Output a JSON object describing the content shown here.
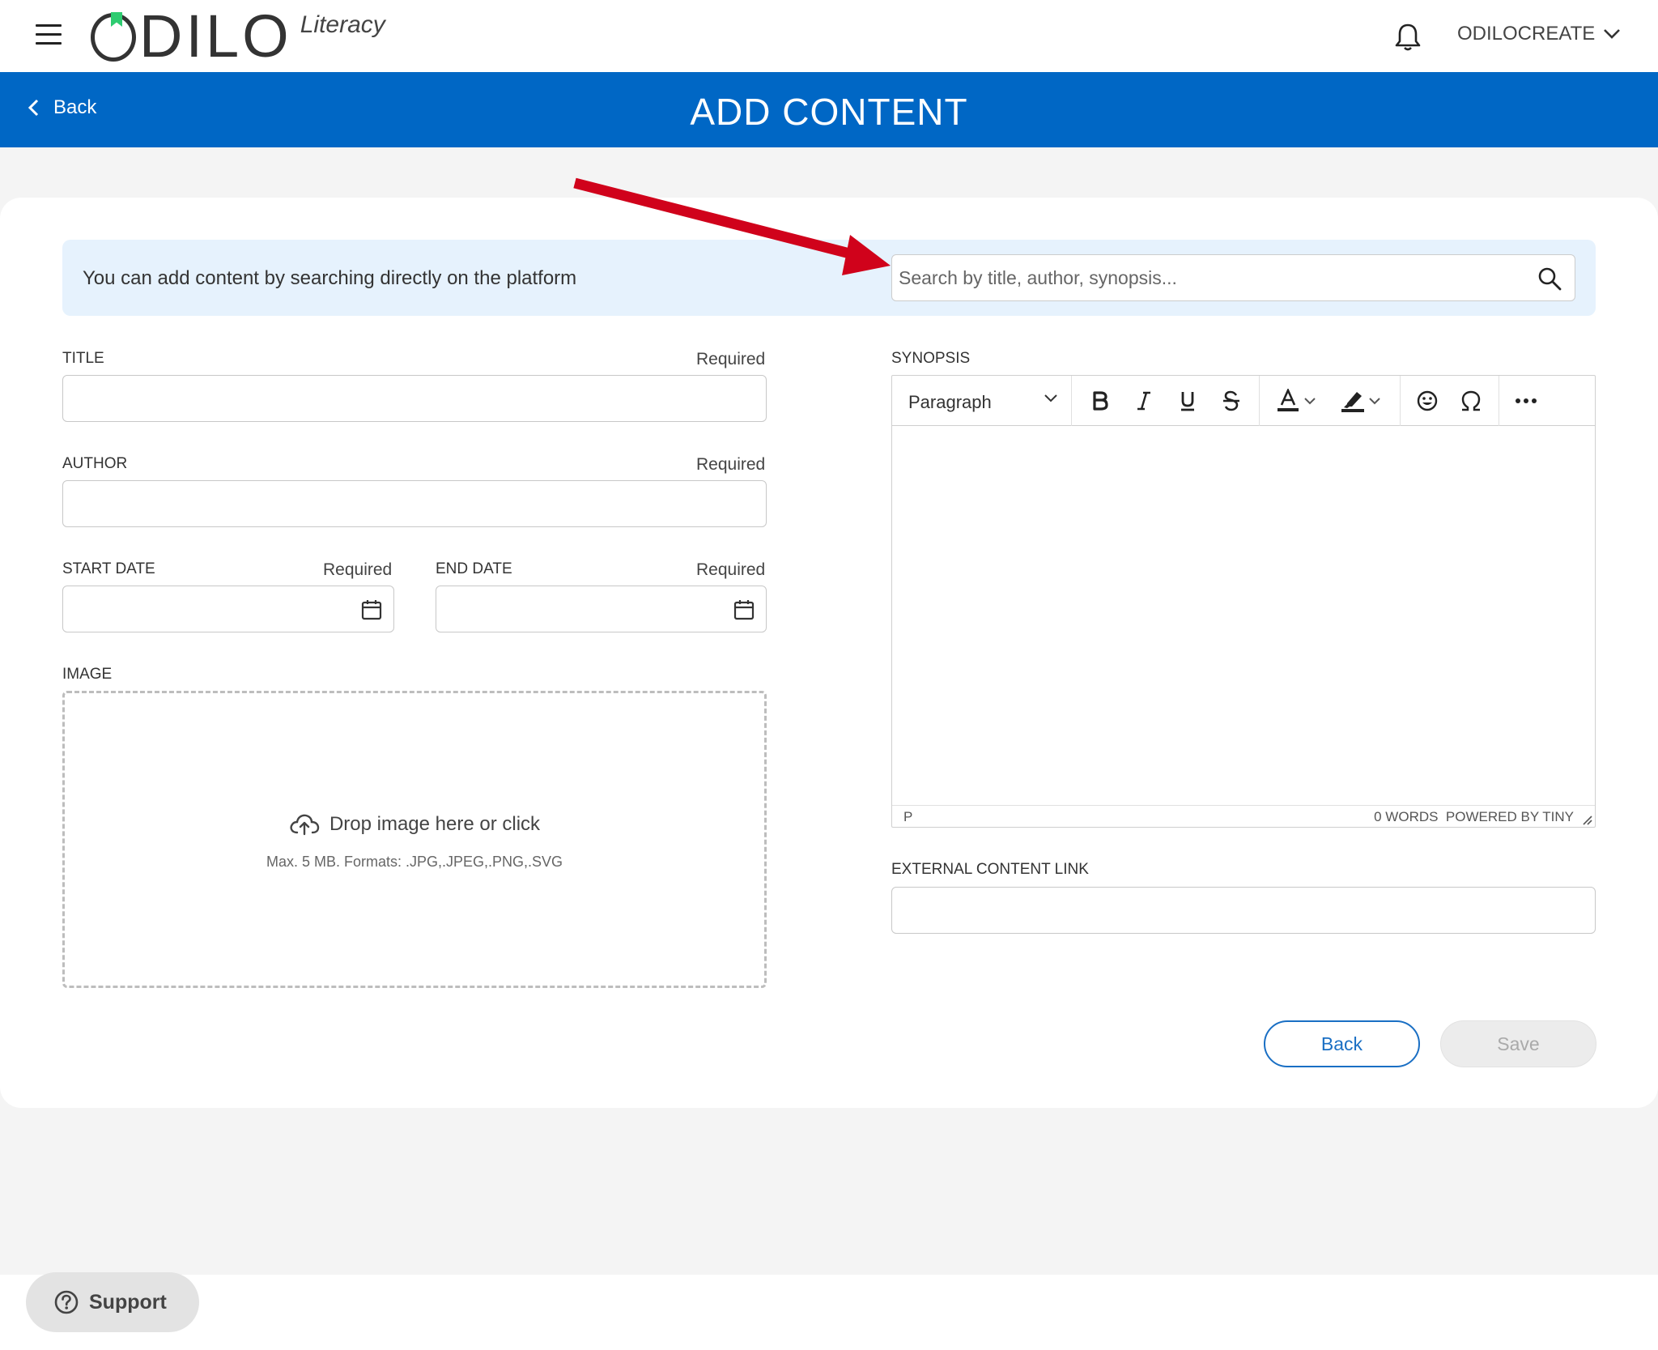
{
  "header": {
    "logo_main": "ODILO",
    "logo_sub": "Literacy",
    "user_name": "ODILOCREATE"
  },
  "titlebar": {
    "back_label": "Back",
    "title": "ADD CONTENT"
  },
  "search": {
    "banner_text": "You can add content by searching directly on the platform",
    "placeholder": "Search by title, author, synopsis..."
  },
  "form": {
    "title_label": "TITLE",
    "author_label": "AUTHOR",
    "start_date_label": "START DATE",
    "end_date_label": "END DATE",
    "image_label": "IMAGE",
    "required_text": "Required",
    "title_value": "",
    "author_value": "",
    "start_date_value": "",
    "end_date_value": "",
    "drop_text": "Drop image here or click",
    "drop_hint": "Max. 5 MB. Formats: .JPG,.JPEG,.PNG,.SVG",
    "synopsis_label": "SYNOPSIS",
    "external_link_label": "EXTERNAL CONTENT LINK",
    "external_link_value": ""
  },
  "editor": {
    "block_format": "Paragraph",
    "status_element": "P",
    "word_count": "0 WORDS",
    "powered_by": "POWERED BY TINY"
  },
  "actions": {
    "back_label": "Back",
    "save_label": "Save"
  },
  "support": {
    "label": "Support"
  },
  "colors": {
    "brand_blue": "#0067c5",
    "banner_bg": "#e6f2fd",
    "logo_accent": "#2ecc71",
    "annotation_arrow": "#d0021b"
  }
}
